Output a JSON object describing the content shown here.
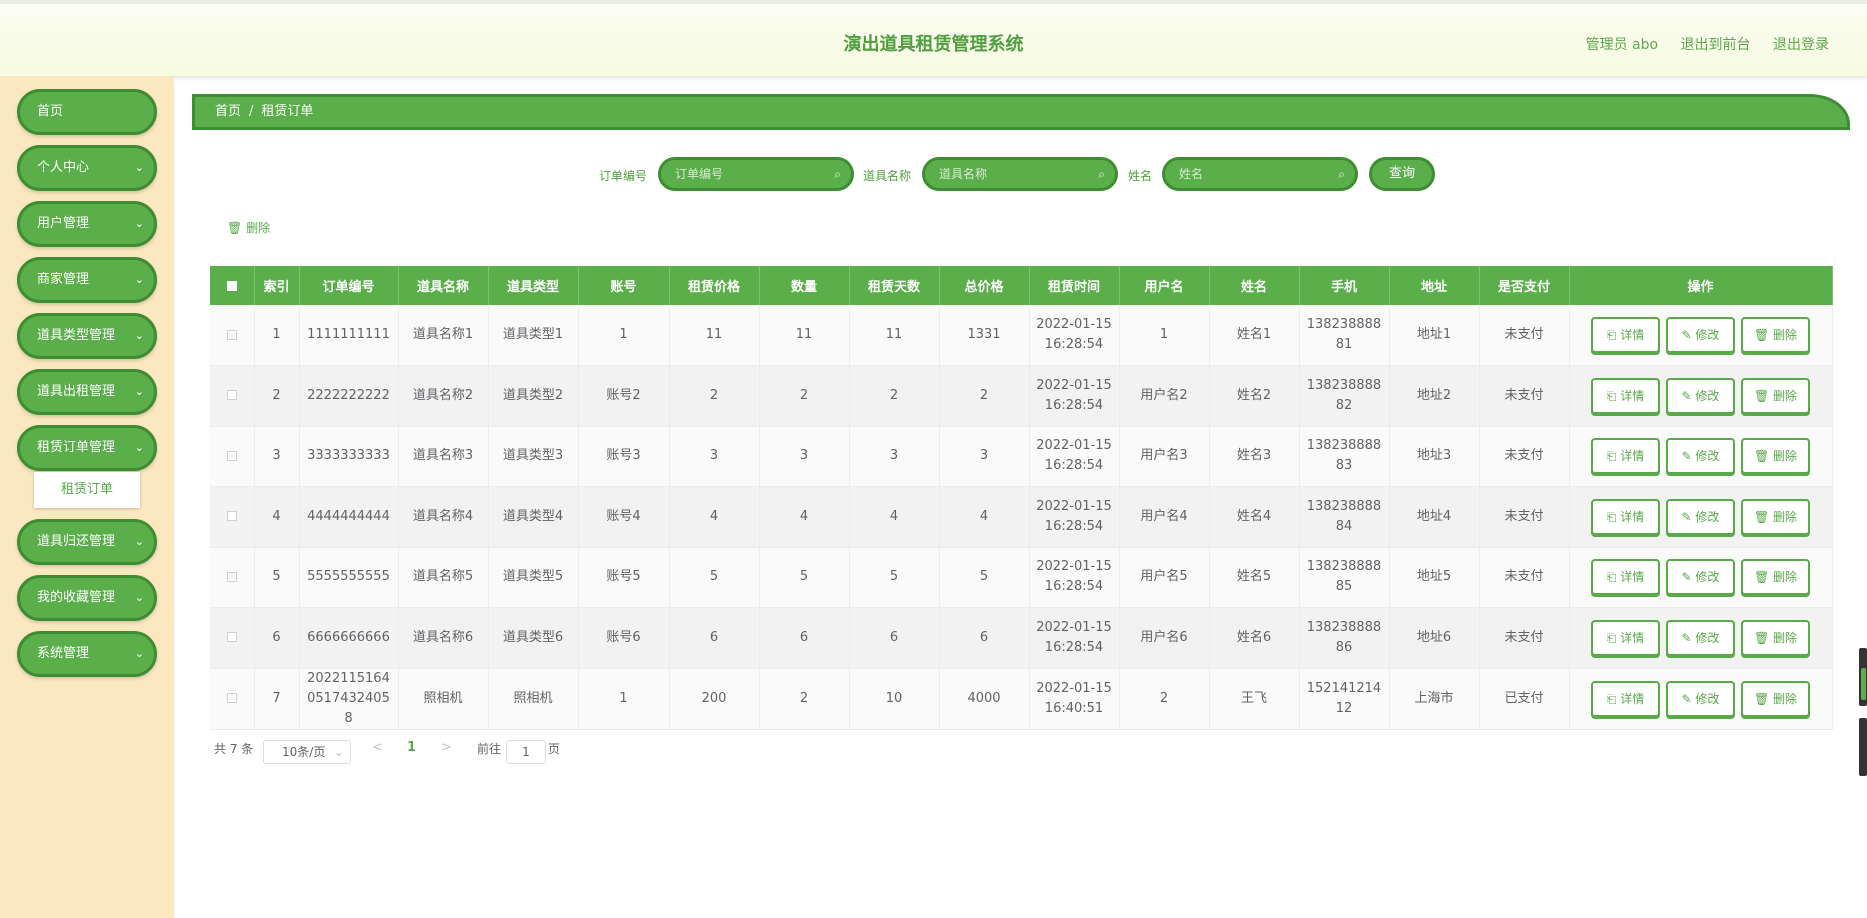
{
  "header": {
    "title": "演出道具租赁管理系统",
    "user": "管理员 abo",
    "to_front": "退出到前台",
    "logout": "退出登录"
  },
  "sidebar": {
    "items": [
      {
        "label": "首页",
        "has_children": false
      },
      {
        "label": "个人中心",
        "has_children": true
      },
      {
        "label": "用户管理",
        "has_children": true
      },
      {
        "label": "商家管理",
        "has_children": true
      },
      {
        "label": "道具类型管理",
        "has_children": true
      },
      {
        "label": "道具出租管理",
        "has_children": true
      },
      {
        "label": "租赁订单管理",
        "has_children": true
      },
      {
        "label": "道具归还管理",
        "has_children": true
      },
      {
        "label": "我的收藏管理",
        "has_children": true
      },
      {
        "label": "系统管理",
        "has_children": true
      }
    ],
    "submenu_active": "租赁订单"
  },
  "breadcrumb": {
    "home": "首页",
    "sep": "/",
    "current": "租赁订单"
  },
  "search": {
    "order_label": "订单编号",
    "order_placeholder": "订单编号",
    "prop_label": "道具名称",
    "prop_placeholder": "道具名称",
    "name_label": "姓名",
    "name_placeholder": "姓名",
    "query": "查询"
  },
  "toolbar": {
    "delete": "删除"
  },
  "table": {
    "headers": [
      "索引",
      "订单编号",
      "道具名称",
      "道具类型",
      "账号",
      "租赁价格",
      "数量",
      "租赁天数",
      "总价格",
      "租赁时间",
      "用户名",
      "姓名",
      "手机",
      "地址",
      "是否支付",
      "操作"
    ],
    "rows": [
      [
        "1",
        "1111111111",
        "道具名称1",
        "道具类型1",
        "1",
        "11",
        "11",
        "11",
        "1331",
        "2022-01-15 16:28:54",
        "1",
        "姓名1",
        "13823888881",
        "地址1",
        "未支付"
      ],
      [
        "2",
        "2222222222",
        "道具名称2",
        "道具类型2",
        "账号2",
        "2",
        "2",
        "2",
        "2",
        "2022-01-15 16:28:54",
        "用户名2",
        "姓名2",
        "13823888882",
        "地址2",
        "未支付"
      ],
      [
        "3",
        "3333333333",
        "道具名称3",
        "道具类型3",
        "账号3",
        "3",
        "3",
        "3",
        "3",
        "2022-01-15 16:28:54",
        "用户名3",
        "姓名3",
        "13823888883",
        "地址3",
        "未支付"
      ],
      [
        "4",
        "4444444444",
        "道具名称4",
        "道具类型4",
        "账号4",
        "4",
        "4",
        "4",
        "4",
        "2022-01-15 16:28:54",
        "用户名4",
        "姓名4",
        "13823888884",
        "地址4",
        "未支付"
      ],
      [
        "5",
        "5555555555",
        "道具名称5",
        "道具类型5",
        "账号5",
        "5",
        "5",
        "5",
        "5",
        "2022-01-15 16:28:54",
        "用户名5",
        "姓名5",
        "13823888885",
        "地址5",
        "未支付"
      ],
      [
        "6",
        "6666666666",
        "道具名称6",
        "道具类型6",
        "账号6",
        "6",
        "6",
        "6",
        "6",
        "2022-01-15 16:28:54",
        "用户名6",
        "姓名6",
        "13823888886",
        "地址6",
        "未支付"
      ],
      [
        "7",
        "202211516405174324058",
        "照相机",
        "照相机",
        "1",
        "200",
        "2",
        "10",
        "4000",
        "2022-01-15 16:40:51",
        "2",
        "王飞",
        "15214121412",
        "上海市",
        "已支付"
      ]
    ],
    "actions": {
      "detail": "详情",
      "edit": "修改",
      "delete": "删除"
    }
  },
  "pagination": {
    "total": "共 7 条",
    "page_size": "10条/页",
    "prev": "<",
    "current": "1",
    "next": ">",
    "goto_label": "前往",
    "goto_value": "1",
    "goto_suffix": "页"
  },
  "colors": {
    "primary": "#5aaf4b",
    "primary_dark": "#3d8d33",
    "sidebar_bg": "#fbe7c0"
  }
}
